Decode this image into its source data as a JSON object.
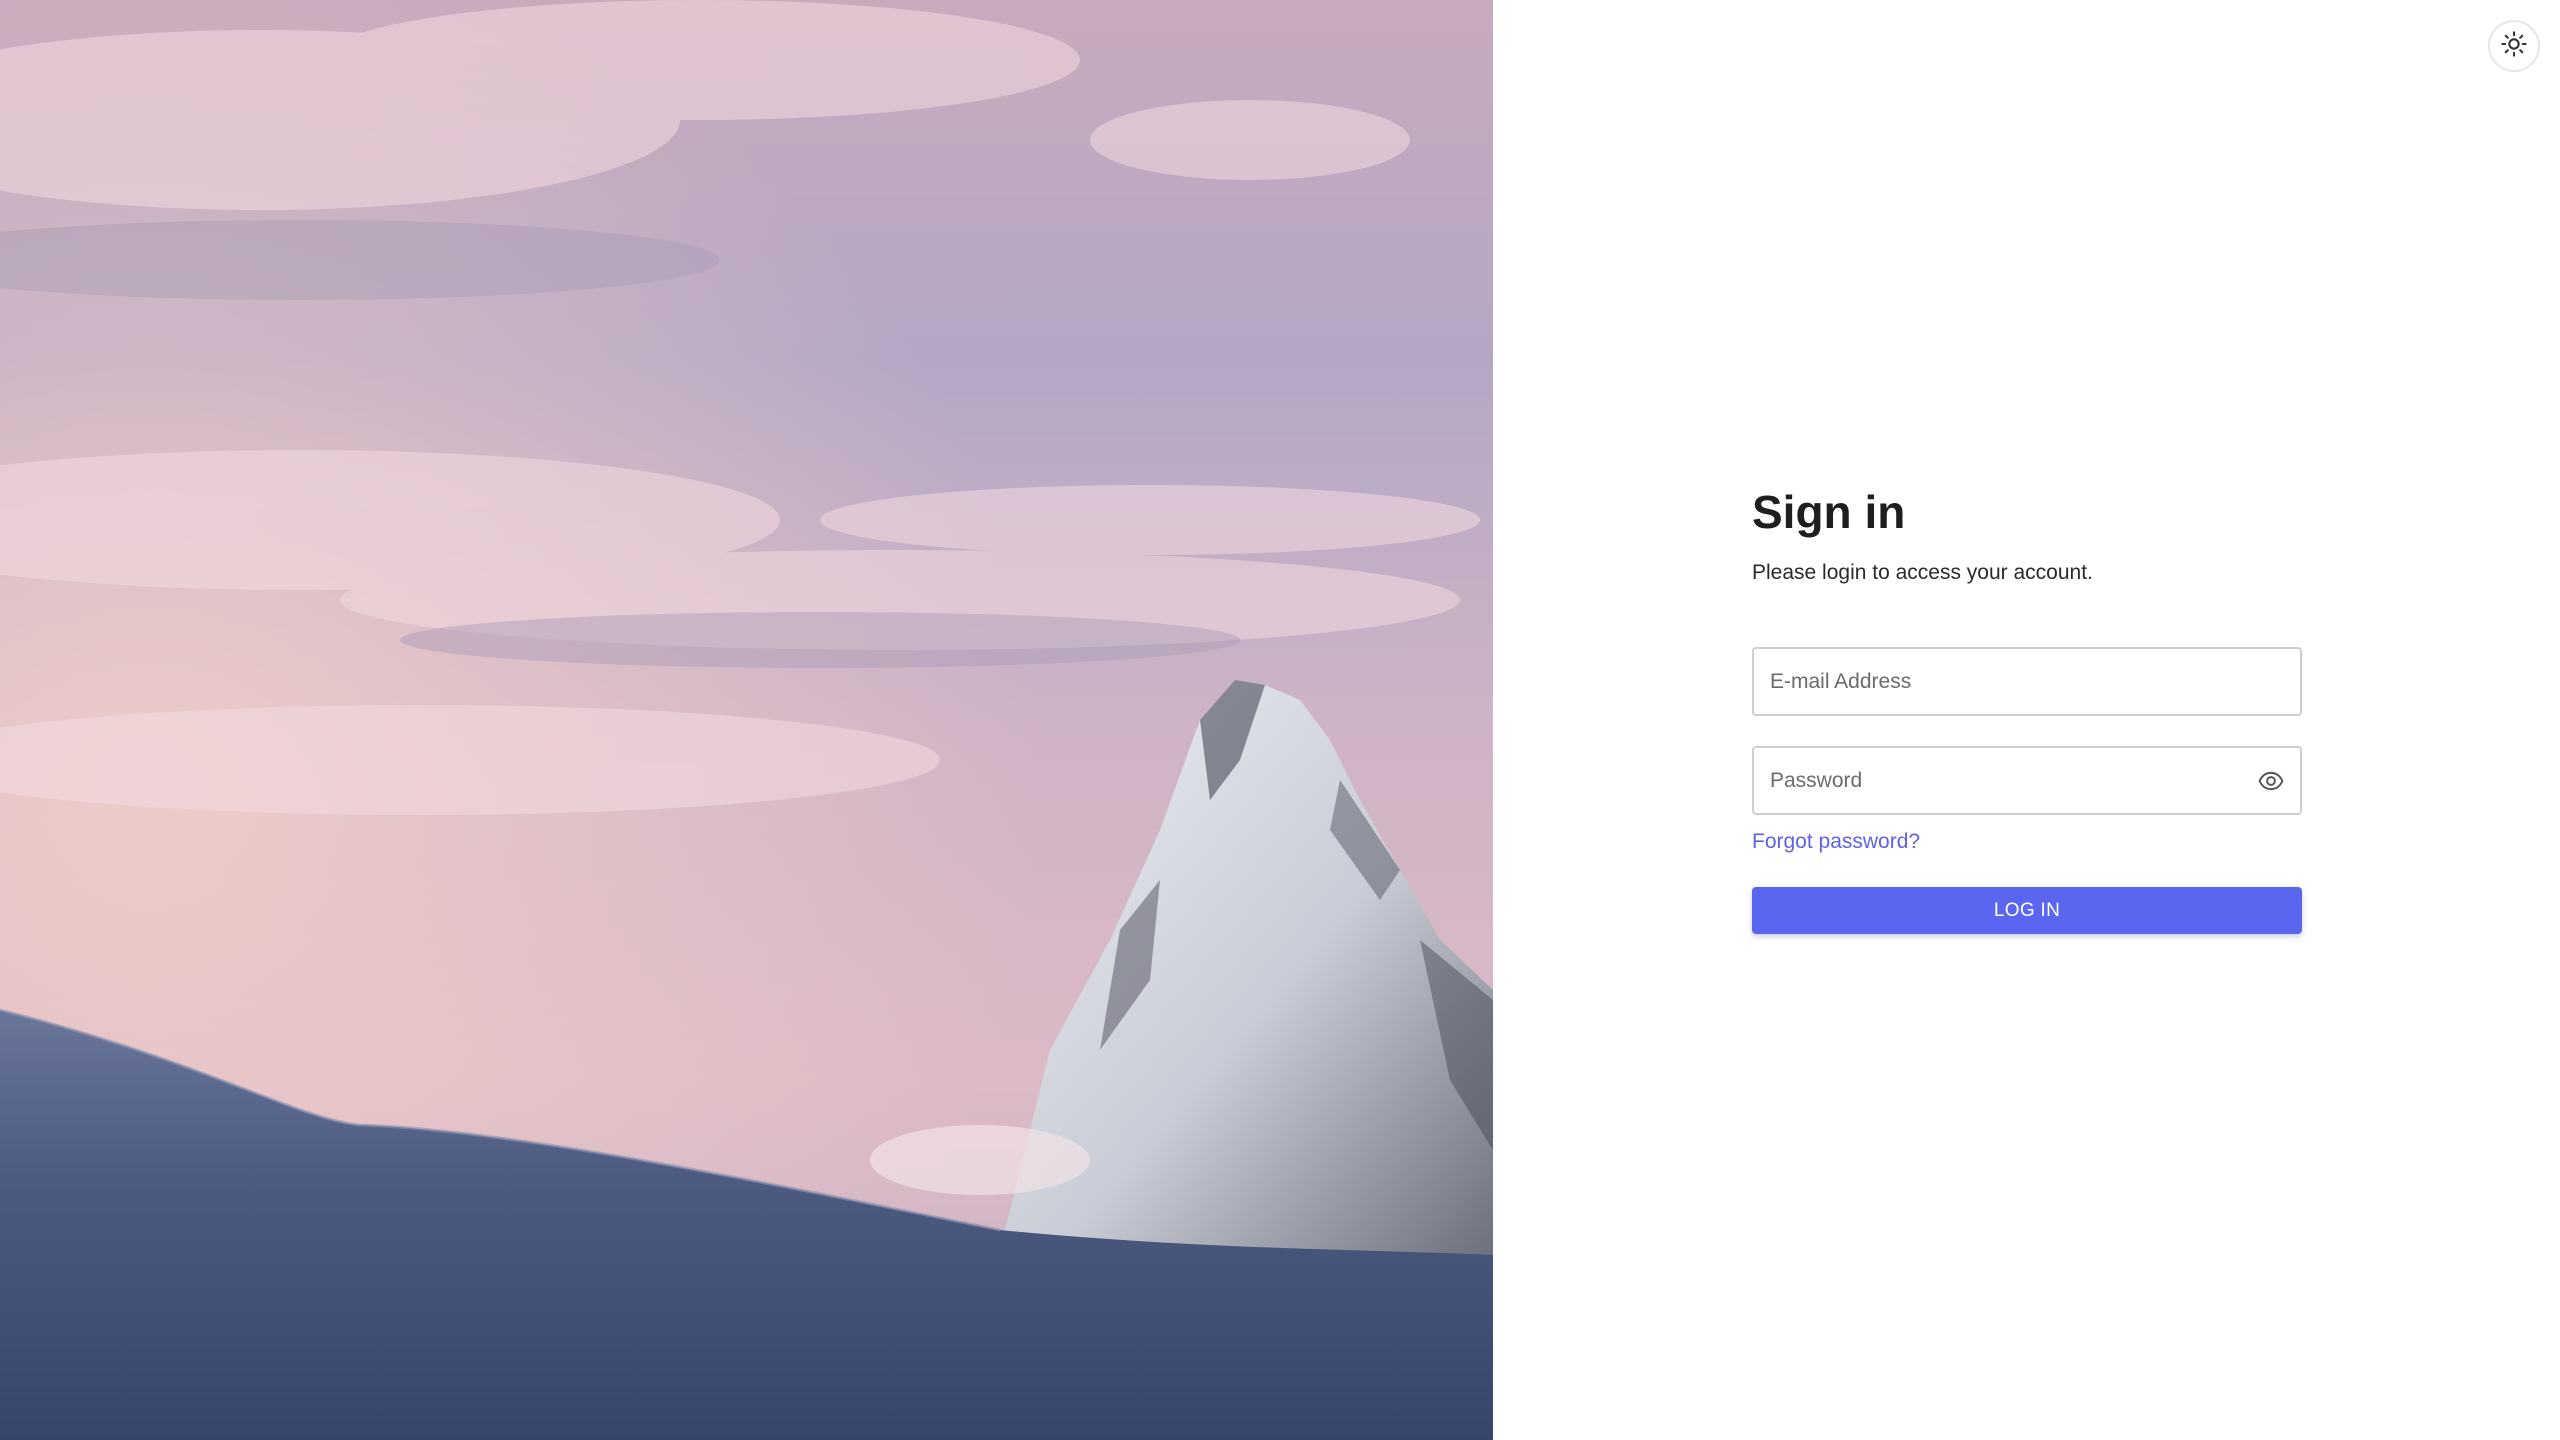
{
  "hero": {
    "image_name": "mountain-peak-at-sunset-photo"
  },
  "theme_toggle": {
    "icon": "sun-icon"
  },
  "form": {
    "title": "Sign in",
    "subtitle": "Please login to access your account.",
    "email": {
      "placeholder": "E-mail Address",
      "value": ""
    },
    "password": {
      "placeholder": "Password",
      "value": "",
      "toggle_icon": "eye-icon"
    },
    "forgot_link": "Forgot password?",
    "login_button": "LOG IN"
  },
  "colors": {
    "accent": "#5a65f0",
    "link": "#5d62e8",
    "title": "#1e1e1e",
    "border": "#cfcfcf"
  }
}
